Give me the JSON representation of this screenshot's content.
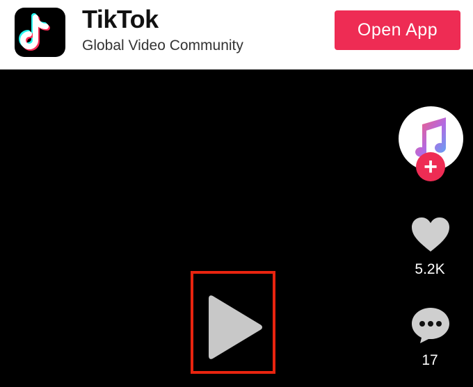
{
  "header": {
    "app_name": "TikTok",
    "app_tagline": "Global Video Community",
    "open_app_label": "Open App",
    "accent_color": "#ee2c54"
  },
  "sidebar": {
    "avatar_icon": "music-note-icon",
    "follow_label": "+",
    "likes_count": "5.2K",
    "comments_count": "17"
  },
  "player": {
    "play_icon": "play-icon",
    "highlight_color": "#e8240f"
  }
}
